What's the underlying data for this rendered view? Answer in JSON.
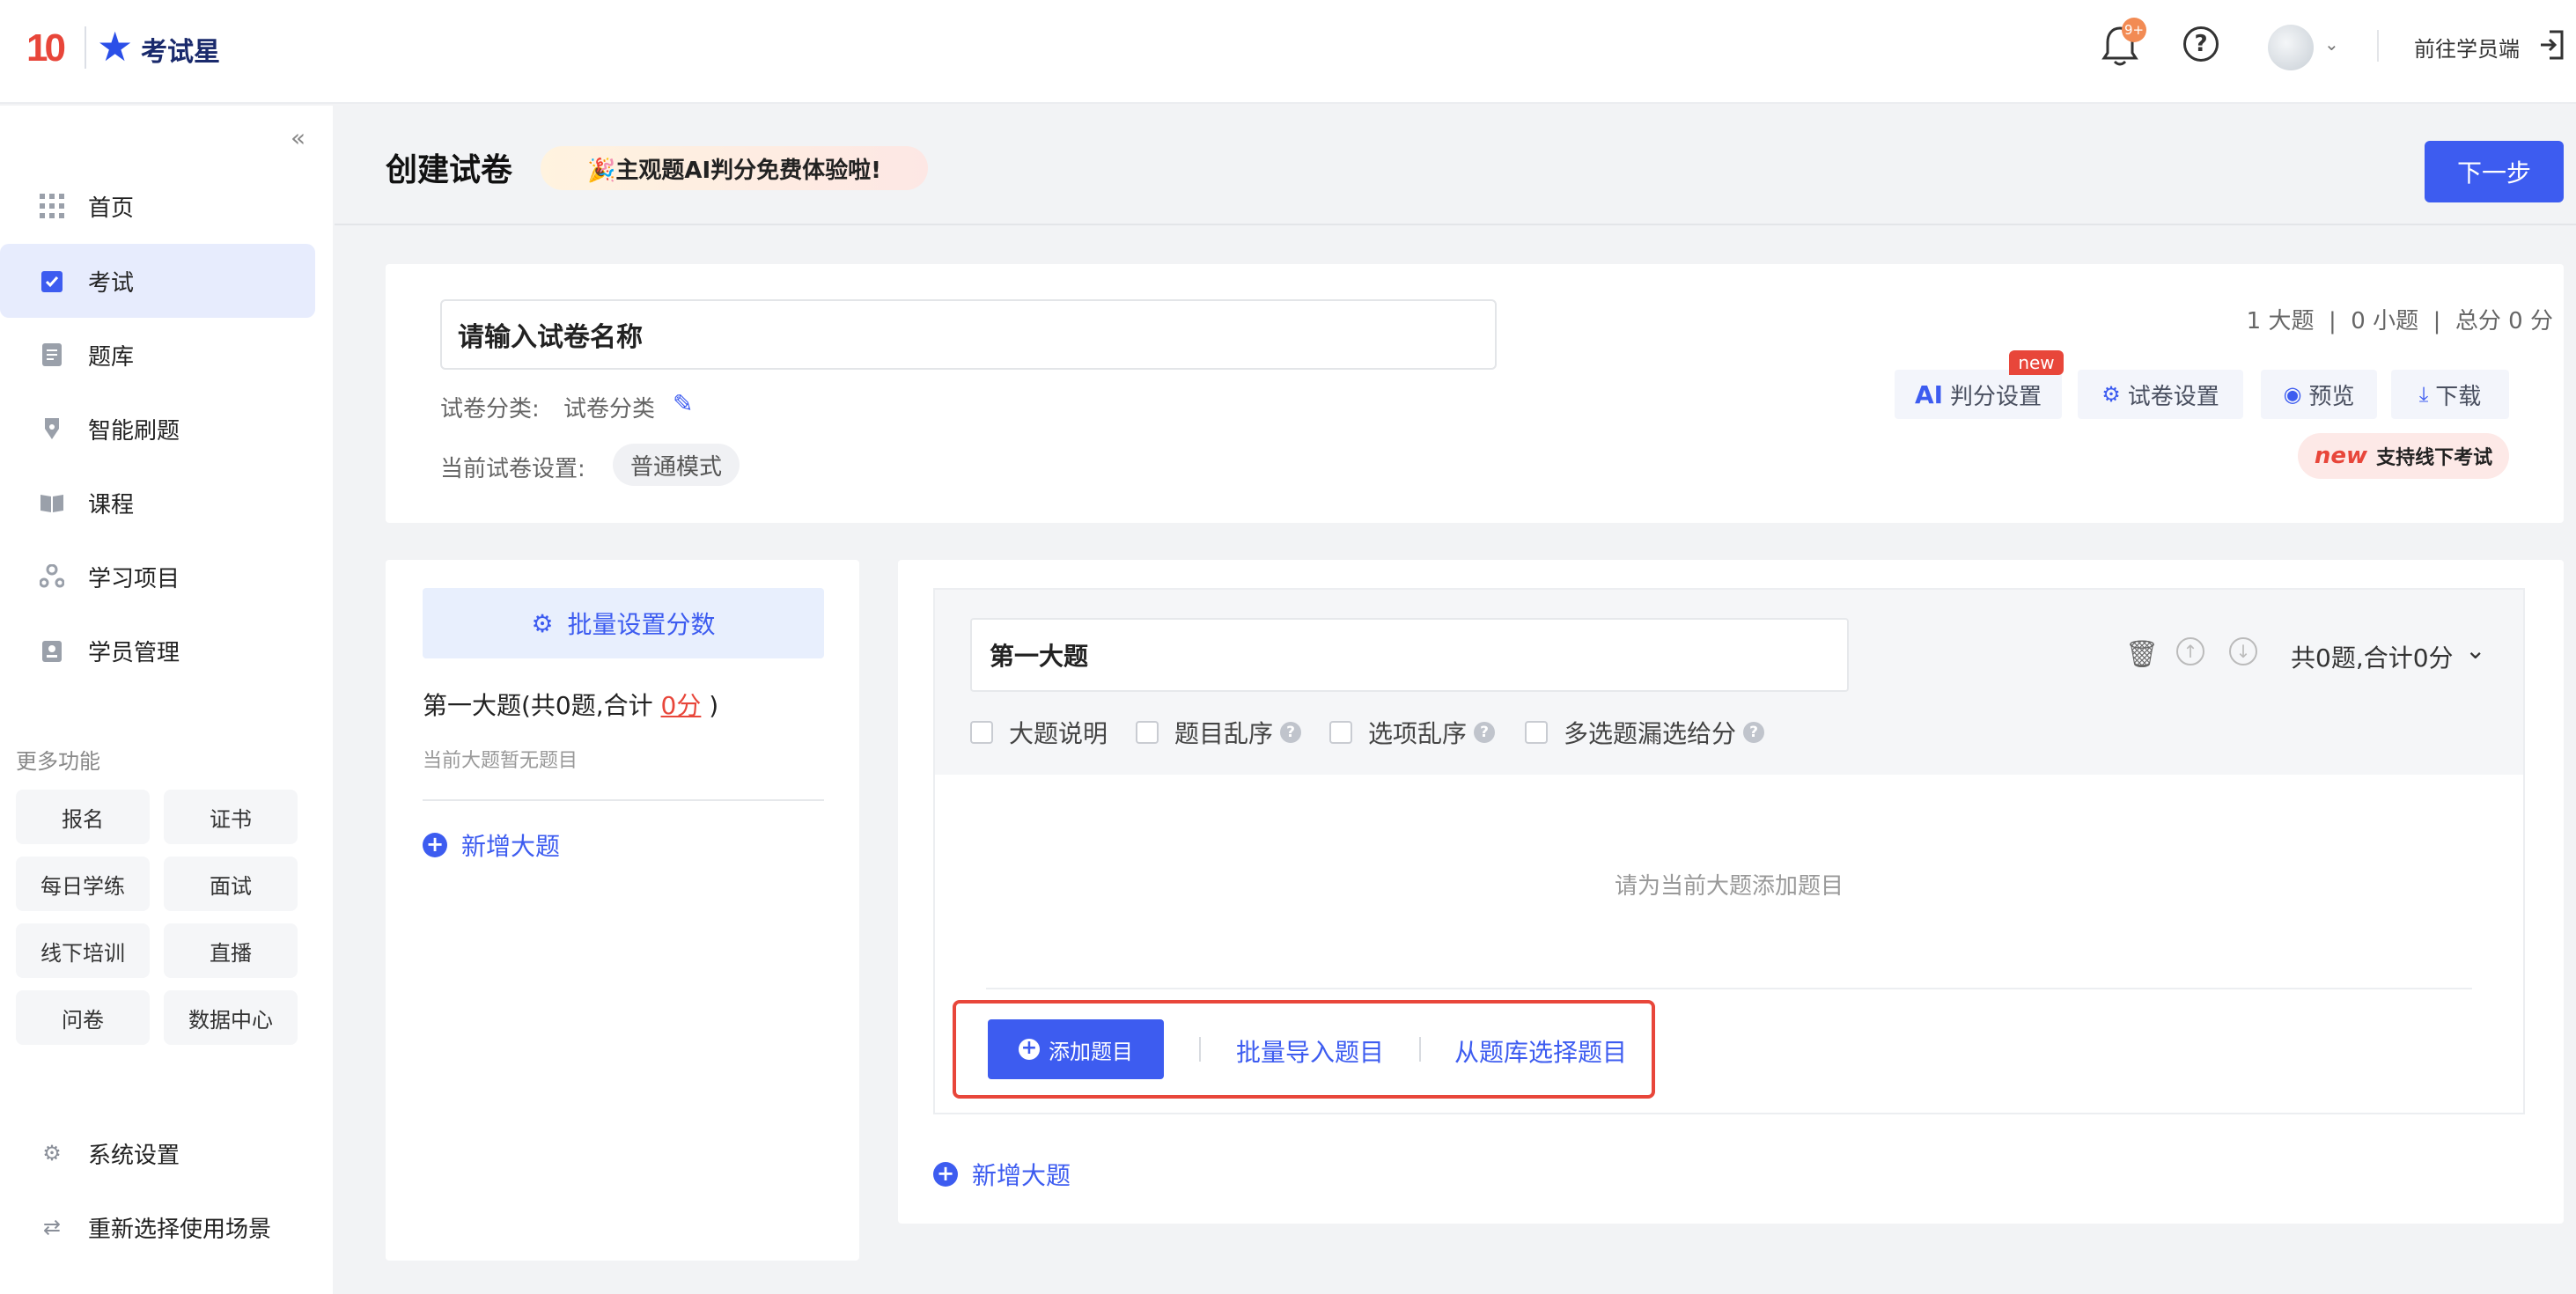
{
  "topbar": {
    "logo_number": "10",
    "logo_text": "考试星",
    "notification_badge": "9+",
    "help_glyph": "?",
    "goto_student": "前往学员端"
  },
  "sidebar": {
    "items": [
      {
        "label": "首页",
        "icon": "grid-icon"
      },
      {
        "label": "考试",
        "icon": "clipboard-check-icon"
      },
      {
        "label": "题库",
        "icon": "document-icon"
      },
      {
        "label": "智能刷题",
        "icon": "pen-nib-icon"
      },
      {
        "label": "课程",
        "icon": "book-icon"
      },
      {
        "label": "学习项目",
        "icon": "project-icon"
      },
      {
        "label": "学员管理",
        "icon": "id-card-icon"
      }
    ],
    "more_title": "更多功能",
    "chips": [
      "报名",
      "证书",
      "每日学练",
      "面试",
      "线下培训",
      "直播",
      "问卷",
      "数据中心"
    ],
    "system_settings": "系统设置",
    "reselect_scene": "重新选择使用场景"
  },
  "header": {
    "title": "创建试卷",
    "promo": "🎉主观题AI判分免费体验啦!",
    "next_button": "下一步"
  },
  "paper_info": {
    "name_placeholder": "请输入试卷名称",
    "category_label": "试卷分类:",
    "category_value": "试卷分类",
    "setting_label": "当前试卷设置:",
    "mode": "普通模式",
    "summary": "1 大题  |  0 小题  |  总分 0 分",
    "tools": {
      "ai_prefix": "AI",
      "ai_label": "判分设置",
      "new_badge": "new",
      "settings_label": "试卷设置",
      "preview_label": "预览",
      "download_label": "下载"
    },
    "offline_new": "new",
    "offline_tip": "支持线下考试"
  },
  "left_panel": {
    "batch_score": "批量设置分数",
    "section_summary_prefix": "第一大题(共0题,合计",
    "section_summary_score": "0分",
    "section_summary_suffix": ")",
    "section_empty": "当前大题暂无题目",
    "add_section": "新增大题"
  },
  "section": {
    "name": "第一大题",
    "total": "共0题,合计0分",
    "options": [
      {
        "label": "大题说明",
        "has_help": false
      },
      {
        "label": "题目乱序",
        "has_help": true
      },
      {
        "label": "选项乱序",
        "has_help": true
      },
      {
        "label": "多选题漏选给分",
        "has_help": true
      }
    ],
    "empty_hint": "请为当前大题添加题目",
    "add_question": "添加题目",
    "batch_import": "批量导入题目",
    "select_from_bank": "从题库选择题目",
    "add_section": "新增大题"
  }
}
